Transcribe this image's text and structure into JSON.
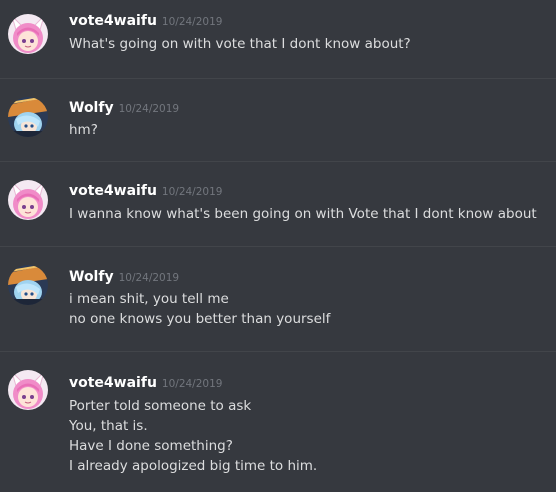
{
  "messages": [
    {
      "username": "vote4waifu",
      "timestamp": "10/24/2019",
      "avatar": "pink-hair-girl-avatar",
      "lines": [
        "What's going on with vote that I dont know about?"
      ]
    },
    {
      "username": "Wolfy",
      "timestamp": "10/24/2019",
      "avatar": "blue-hair-character-avatar",
      "lines": [
        "hm?"
      ]
    },
    {
      "username": "vote4waifu",
      "timestamp": "10/24/2019",
      "avatar": "pink-hair-girl-avatar",
      "lines": [
        "I wanna know what's been going on with Vote that I dont know about"
      ]
    },
    {
      "username": "Wolfy",
      "timestamp": "10/24/2019",
      "avatar": "blue-hair-character-avatar",
      "lines": [
        "i mean shit, you tell me",
        "no one knows you better than yourself"
      ]
    },
    {
      "username": "vote4waifu",
      "timestamp": "10/24/2019",
      "avatar": "pink-hair-girl-avatar",
      "lines": [
        "Porter told someone to ask",
        "You, that is.",
        "Have I done something?",
        "I already apologized big time to him."
      ]
    }
  ],
  "colors": {
    "background": "#36393f",
    "username": "#ffffff",
    "timestamp": "#72767d",
    "text": "#dcddde",
    "divider": "#42454a"
  }
}
